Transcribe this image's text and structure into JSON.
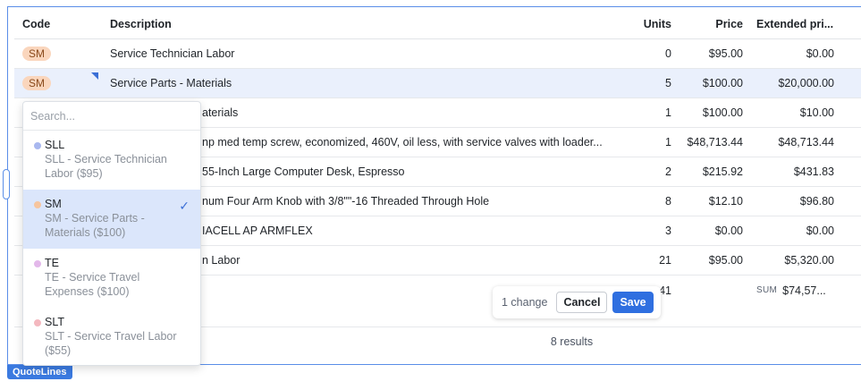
{
  "table": {
    "columns": {
      "code": "Code",
      "description": "Description",
      "units": "Units",
      "price": "Price",
      "extended": "Extended pri..."
    },
    "rows": [
      {
        "code": "SM",
        "description": "Service Technician Labor",
        "units": "0",
        "price": "$95.00",
        "extended": "$0.00"
      },
      {
        "code": "SM",
        "description": "Service Parts - Materials",
        "units": "5",
        "price": "$100.00",
        "extended": "$20,000.00"
      },
      {
        "code": "",
        "description": "aterials",
        "units": "1",
        "price": "$100.00",
        "extended": "$10.00"
      },
      {
        "code": "",
        "description": "np med temp screw, economized, 460V, oil less, with service valves with loader...",
        "units": "1",
        "price": "$48,713.44",
        "extended": "$48,713.44"
      },
      {
        "code": "",
        "description": "55-Inch Large Computer Desk, Espresso",
        "units": "2",
        "price": "$215.92",
        "extended": "$431.83"
      },
      {
        "code": "",
        "description": "num Four Arm Knob with 3/8\"\"-16 Threaded Through Hole",
        "units": "8",
        "price": "$12.10",
        "extended": "$96.80"
      },
      {
        "code": "",
        "description": "IACELL AP ARMFLEX",
        "units": "3",
        "price": "$0.00",
        "extended": "$0.00"
      },
      {
        "code": "",
        "description": "n Labor",
        "units": "21",
        "price": "$95.00",
        "extended": "$5,320.00"
      }
    ],
    "summary": {
      "units": "41",
      "sum_label": "SUM",
      "extended": "$74,57..."
    },
    "results": "8 results"
  },
  "changes": {
    "count": "1 change",
    "cancel": "Cancel",
    "save": "Save"
  },
  "dropdown": {
    "search_placeholder": "Search...",
    "options": [
      {
        "name": "SLL",
        "sub": "SLL - Service Technician Labor ($95)",
        "color": "#a9b8ef"
      },
      {
        "name": "SM",
        "sub": "SM - Service Parts - Materials ($100)",
        "color": "#f6c59e"
      },
      {
        "name": "TE",
        "sub": "TE - Service Travel Expenses ($100)",
        "color": "#e3b8ea"
      },
      {
        "name": "SLT",
        "sub": "SLT - Service Travel Labor ($55)",
        "color": "#f4b8bf"
      }
    ]
  },
  "widget_label": "QuoteLines"
}
